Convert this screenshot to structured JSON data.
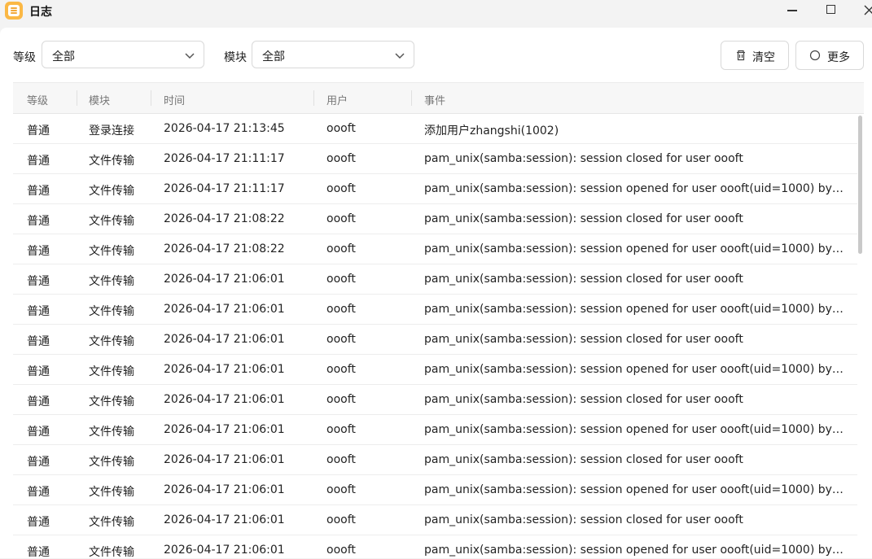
{
  "window": {
    "title": "日志",
    "icons": {
      "app": "log-app-icon",
      "minimize": "minimize-icon",
      "maximize": "maximize-icon",
      "close": "close-icon"
    }
  },
  "filters": {
    "level_label": "等级",
    "level_value": "全部",
    "module_label": "模块",
    "module_value": "全部"
  },
  "toolbar": {
    "clear_label": "清空",
    "more_label": "更多",
    "clear_icon": "trash-icon",
    "more_icon": "circle-icon"
  },
  "table": {
    "columns": [
      "等级",
      "模块",
      "时间",
      "用户",
      "事件"
    ],
    "rows": [
      [
        "普通",
        "登录连接",
        "2026-04-17 21:13:45",
        "oooft",
        "添加用户zhangshi(1002)"
      ],
      [
        "普通",
        "文件传输",
        "2026-04-17 21:11:17",
        "oooft",
        "pam_unix(samba:session): session closed for user oooft"
      ],
      [
        "普通",
        "文件传输",
        "2026-04-17 21:11:17",
        "oooft",
        "pam_unix(samba:session): session opened for user oooft(uid=1000) by (uid..."
      ],
      [
        "普通",
        "文件传输",
        "2026-04-17 21:08:22",
        "oooft",
        "pam_unix(samba:session): session closed for user oooft"
      ],
      [
        "普通",
        "文件传输",
        "2026-04-17 21:08:22",
        "oooft",
        "pam_unix(samba:session): session opened for user oooft(uid=1000) by (uid..."
      ],
      [
        "普通",
        "文件传输",
        "2026-04-17 21:06:01",
        "oooft",
        "pam_unix(samba:session): session closed for user oooft"
      ],
      [
        "普通",
        "文件传输",
        "2026-04-17 21:06:01",
        "oooft",
        "pam_unix(samba:session): session opened for user oooft(uid=1000) by (uid..."
      ],
      [
        "普通",
        "文件传输",
        "2026-04-17 21:06:01",
        "oooft",
        "pam_unix(samba:session): session closed for user oooft"
      ],
      [
        "普通",
        "文件传输",
        "2026-04-17 21:06:01",
        "oooft",
        "pam_unix(samba:session): session opened for user oooft(uid=1000) by (uid..."
      ],
      [
        "普通",
        "文件传输",
        "2026-04-17 21:06:01",
        "oooft",
        "pam_unix(samba:session): session closed for user oooft"
      ],
      [
        "普通",
        "文件传输",
        "2026-04-17 21:06:01",
        "oooft",
        "pam_unix(samba:session): session opened for user oooft(uid=1000) by (uid..."
      ],
      [
        "普通",
        "文件传输",
        "2026-04-17 21:06:01",
        "oooft",
        "pam_unix(samba:session): session closed for user oooft"
      ],
      [
        "普通",
        "文件传输",
        "2026-04-17 21:06:01",
        "oooft",
        "pam_unix(samba:session): session opened for user oooft(uid=1000) by (uid..."
      ],
      [
        "普通",
        "文件传输",
        "2026-04-17 21:06:01",
        "oooft",
        "pam_unix(samba:session): session closed for user oooft"
      ],
      [
        "普通",
        "文件传输",
        "2026-04-17 21:06:01",
        "oooft",
        "pam_unix(samba:session): session opened for user oooft(uid=1000) by (uid..."
      ]
    ]
  }
}
